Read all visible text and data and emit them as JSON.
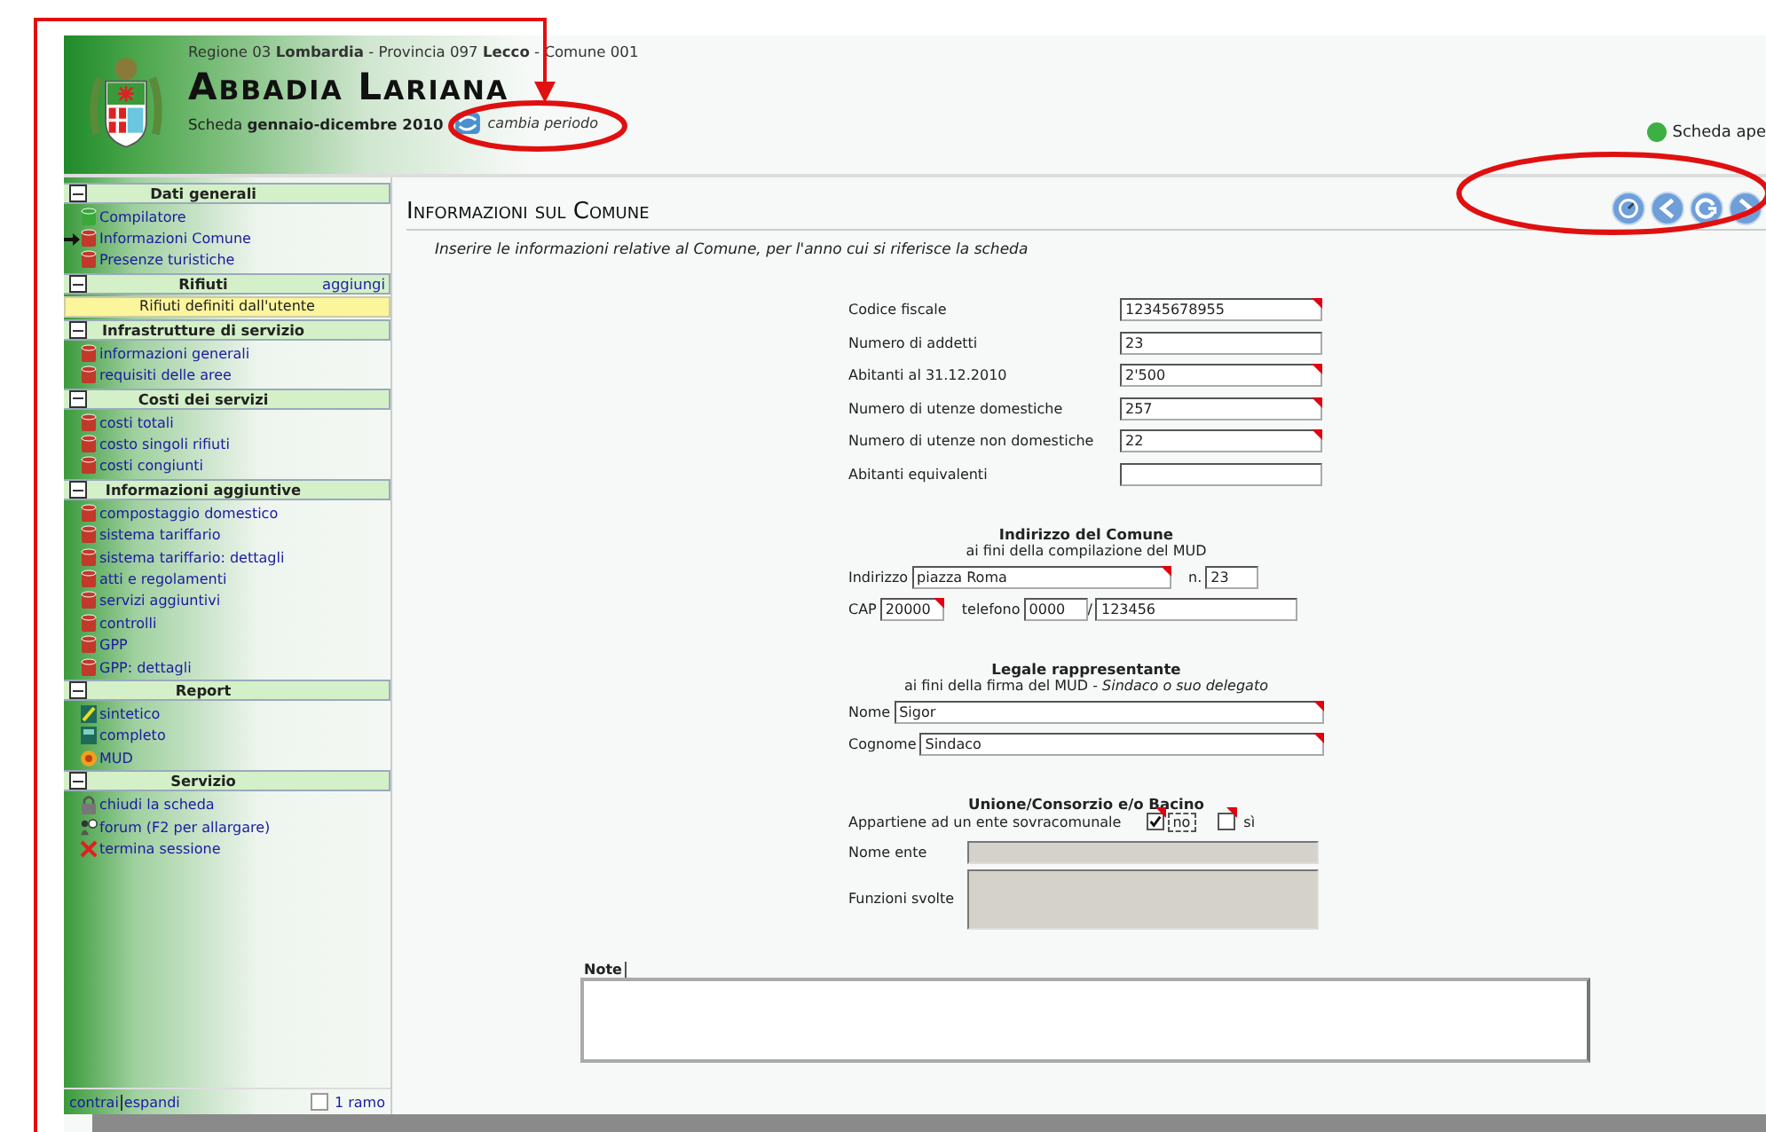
{
  "header": {
    "location": "Regione 03 **Lombardia** - Provincia 097 **Lecco**  - Comune 001",
    "title": "Abbadia Lariana",
    "period": "Scheda **gennaio-dicembre 2010**",
    "change_period": "cambia periodo",
    "status": {
      "label": "Scheda ape",
      "color": "#3cb043"
    }
  },
  "sidebar": {
    "sections": [
      {
        "title": "Dati generali",
        "expanded": true,
        "items": [
          {
            "label": "Compilatore",
            "kind": "page",
            "color": "#3aa83a",
            "selected": false
          },
          {
            "label": "Informazioni Comune",
            "kind": "page",
            "color": "#c0392b",
            "selected": true
          },
          {
            "label": "Presenze turistiche",
            "kind": "page",
            "color": "#c0392b",
            "selected": false
          }
        ]
      },
      {
        "title": "Rifiuti",
        "action": "aggiungi",
        "expanded": true,
        "items": [
          {
            "label": "Rifiuti definiti dall'utente",
            "kind": "note",
            "selected": false
          }
        ]
      },
      {
        "title": "Infrastrutture di servizio",
        "expanded": true,
        "items": [
          {
            "label": "informazioni generali",
            "kind": "page",
            "color": "#c0392b",
            "selected": false
          },
          {
            "label": "requisiti delle aree",
            "kind": "page",
            "color": "#c0392b",
            "selected": false
          }
        ]
      },
      {
        "title": "Costi dei servizi",
        "expanded": true,
        "items": [
          {
            "label": "costi totali",
            "kind": "page",
            "color": "#c0392b",
            "selected": false
          },
          {
            "label": "costo singoli rifiuti",
            "kind": "page",
            "color": "#c0392b",
            "selected": false
          },
          {
            "label": "costi congiunti",
            "kind": "page",
            "color": "#c0392b",
            "selected": false
          }
        ]
      },
      {
        "title": "Informazioni aggiuntive",
        "expanded": true,
        "items": [
          {
            "label": "compostaggio domestico",
            "kind": "page",
            "color": "#c0392b",
            "selected": false
          },
          {
            "label": "sistema tariffario",
            "kind": "page",
            "color": "#c0392b",
            "selected": false
          },
          {
            "label": "sistema tariffario: dettagli",
            "kind": "page",
            "color": "#c0392b",
            "selected": false
          },
          {
            "label": "atti e regolamenti",
            "kind": "page",
            "color": "#c0392b",
            "selected": false
          },
          {
            "label": "servizi aggiuntivi",
            "kind": "page",
            "color": "#c0392b",
            "selected": false
          },
          {
            "label": "controlli",
            "kind": "page",
            "color": "#c0392b",
            "selected": false
          },
          {
            "label": "GPP",
            "kind": "page",
            "color": "#c0392b",
            "selected": false
          },
          {
            "label": "GPP: dettagli",
            "kind": "page",
            "color": "#c0392b",
            "selected": false
          }
        ]
      },
      {
        "title": "Report",
        "expanded": true,
        "items": [
          {
            "label": "sintetico",
            "kind": "report-summary",
            "selected": false
          },
          {
            "label": "completo",
            "kind": "report-full",
            "selected": false
          },
          {
            "label": "MUD",
            "kind": "flower",
            "selected": false
          }
        ]
      },
      {
        "title": "Servizio",
        "expanded": true,
        "items": [
          {
            "label": "chiudi la scheda",
            "kind": "lock",
            "selected": false
          },
          {
            "label": "forum (F2 per allargare)",
            "kind": "forum",
            "selected": false
          },
          {
            "label": "termina sessione",
            "kind": "close",
            "selected": false
          }
        ]
      }
    ],
    "footer": {
      "collapse": "contrai",
      "expand": "espandi",
      "branch": {
        "label": "1 ramo",
        "checked": false
      }
    }
  },
  "main": {
    "title": "Informazioni sul Comune",
    "nav": [
      {
        "kind": "clock"
      },
      {
        "kind": "back"
      },
      {
        "kind": "refresh"
      },
      {
        "kind": "forward"
      }
    ],
    "intro": "Inserire le informazioni relative al Comune, per l'anno cui si riferisce la scheda",
    "fields": [
      {
        "label": "Codice fiscale",
        "value": "12345678955",
        "required": true
      },
      {
        "label": "Numero di addetti",
        "value": "23",
        "required": false
      },
      {
        "label": "Abitanti al 31.12.2010",
        "value": "2'500",
        "required": true
      },
      {
        "label": "Numero di utenze domestiche",
        "value": "257",
        "required": true
      },
      {
        "label": "Numero di utenze non domestiche",
        "value": "22",
        "required": true
      },
      {
        "label": "Abitanti equivalenti",
        "required": false
      }
    ],
    "address": {
      "title": "Indirizzo del Comune",
      "subtitle": "ai fini della compilazione del MUD",
      "street": {
        "label": "Indirizzo",
        "value": "piazza Roma",
        "required": true
      },
      "number": {
        "label": "n.",
        "value": "23",
        "required": false
      },
      "cap": {
        "label": "CAP",
        "value": "20000",
        "required": true
      },
      "phone": {
        "label": "telefono",
        "prefix": "0000",
        "separator": "/",
        "number": "123456"
      }
    },
    "legal": {
      "title": "Legale rappresentante",
      "subtitle": "ai fini della firma del MUD - *Sindaco o suo delegato*",
      "fields": [
        {
          "label": "Nome",
          "value": "Sigor",
          "required": true
        },
        {
          "label": "Cognome",
          "value": "Sindaco",
          "required": true
        }
      ]
    },
    "union": {
      "title": "Unione/Consorzio e/o Bacino",
      "question": "Appartiene ad un ente sovracomunale",
      "options": [
        {
          "label": "no",
          "checked": true,
          "focused": true
        },
        {
          "label": "sì",
          "checked": false,
          "focused": false
        }
      ],
      "name_label": "Nome ente",
      "functions_label": "Funzioni svolte",
      "disabled": true
    },
    "note": {
      "label": "Note"
    }
  }
}
